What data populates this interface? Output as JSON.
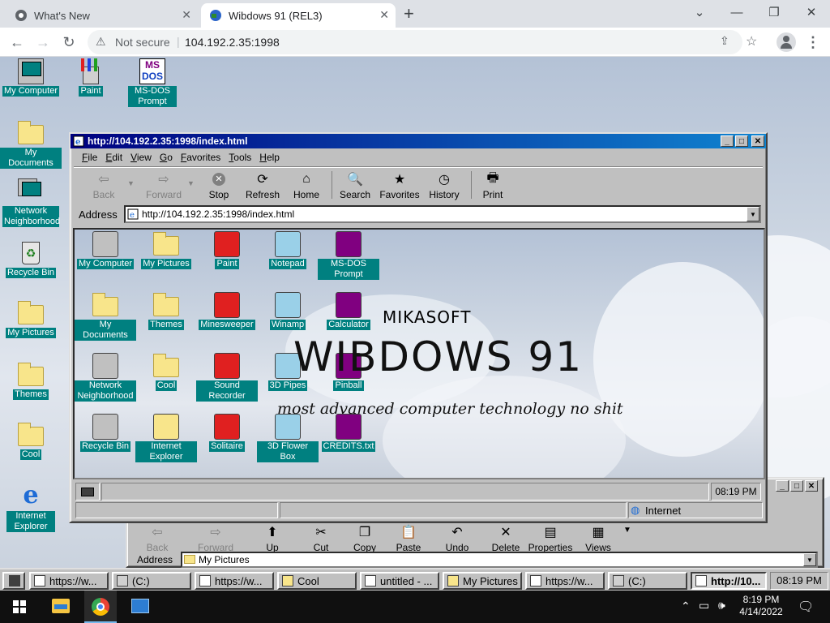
{
  "chrome": {
    "tabs": [
      {
        "title": "What's New"
      },
      {
        "title": "Wibdows 91 (REL3)"
      }
    ],
    "new_tab": "+",
    "url_warning": "Not secure",
    "url": "104.192.2.35:1998"
  },
  "desktop_icons": [
    {
      "label": "My Computer"
    },
    {
      "label": "Paint"
    },
    {
      "label": "MS-DOS Prompt"
    },
    {
      "label": "My Documents"
    },
    {
      "label": "Network Neighborhood"
    },
    {
      "label": "Recycle Bin"
    },
    {
      "label": "My Pictures"
    },
    {
      "label": "Themes"
    },
    {
      "label": "Cool"
    },
    {
      "label": "Internet Explorer"
    }
  ],
  "ie": {
    "title": "http://104.192.2.35:1998/index.html",
    "menu": [
      "File",
      "Edit",
      "View",
      "Go",
      "Favorites",
      "Tools",
      "Help"
    ],
    "toolbar": [
      "Back",
      "Forward",
      "Stop",
      "Refresh",
      "Home",
      "Search",
      "Favorites",
      "History",
      "Print"
    ],
    "address_label": "Address",
    "address": "http://104.192.2.35:1998/index.html",
    "status_time": "08:19 PM",
    "status_zone": "Internet",
    "page": {
      "brand": "MIKASOFT",
      "heading": "WIBDOWS 91",
      "tagline": "most advanced computer technology no shit",
      "icons": [
        {
          "label": "My Computer"
        },
        {
          "label": "My Pictures"
        },
        {
          "label": "Paint"
        },
        {
          "label": "Notepad"
        },
        {
          "label": "MS-DOS Prompt"
        },
        {
          "label": "My Documents"
        },
        {
          "label": "Themes"
        },
        {
          "label": "Minesweeper"
        },
        {
          "label": "Winamp"
        },
        {
          "label": "Calculator"
        },
        {
          "label": "Network Neighborhood"
        },
        {
          "label": "Cool"
        },
        {
          "label": "Sound Recorder"
        },
        {
          "label": "3D Pipes"
        },
        {
          "label": "Pinball"
        },
        {
          "label": "Recycle Bin"
        },
        {
          "label": "Internet Explorer"
        },
        {
          "label": "Solitaire"
        },
        {
          "label": "3D Flower Box"
        },
        {
          "label": "CREDITS.txt"
        }
      ]
    }
  },
  "explorer": {
    "toolbar": [
      "Back",
      "Forward",
      "Up",
      "Cut",
      "Copy",
      "Paste",
      "Undo",
      "Delete",
      "Properties",
      "Views"
    ],
    "address_label": "Address",
    "address": "My Pictures"
  },
  "w98_taskbar": {
    "items": [
      "https://w...",
      "(C:)",
      "https://w...",
      "Cool",
      "untitled - ...",
      "My Pictures",
      "https://w...",
      "(C:)",
      "http://10..."
    ],
    "clock": "08:19 PM"
  },
  "win10": {
    "time": "8:19 PM",
    "date": "4/14/2022"
  },
  "colors": {
    "w98_teal": "#008080",
    "w98_titlebar": "#000080",
    "w98_gray": "#c0c0c0"
  }
}
